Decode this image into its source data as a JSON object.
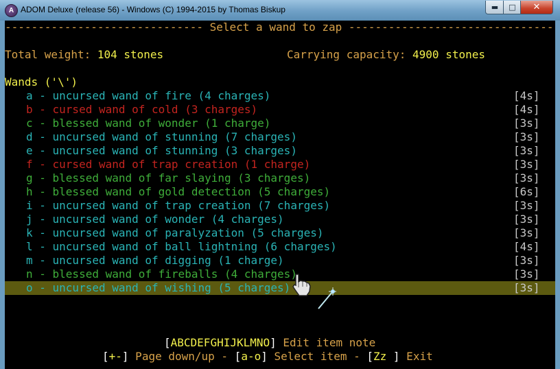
{
  "window": {
    "title": "ADOM Deluxe (release 56) - Windows (C) 1994-2015 by Thomas Biskup",
    "icon_label": "A",
    "buttons": {
      "minimize": "▬",
      "maximize": "□",
      "close": "✕"
    }
  },
  "header": {
    "rule_left": "------------------------------",
    "title": " Select a wand to zap ",
    "rule_right": "--------------------------------"
  },
  "stats": {
    "weight_label": "Total weight: ",
    "weight_value": "104 stones",
    "capacity_label": "Carrying capacity: ",
    "capacity_value": "4900 stones"
  },
  "category": "Wands ('\\')",
  "colors": {
    "uncursed": "#2ab4b6",
    "cursed": "#c3241f",
    "blessed": "#3fae3a",
    "selected_bg": "#5c5a10"
  },
  "items": [
    {
      "key": "a",
      "text": "a - uncursed wand of fire (4 charges)",
      "weight": "[4s]",
      "status": "uncursed"
    },
    {
      "key": "b",
      "text": "b - cursed wand of cold (3 charges)",
      "weight": "[4s]",
      "status": "cursed"
    },
    {
      "key": "c",
      "text": "c - blessed wand of wonder (1 charge)",
      "weight": "[3s]",
      "status": "blessed"
    },
    {
      "key": "d",
      "text": "d - uncursed wand of stunning (7 charges)",
      "weight": "[3s]",
      "status": "uncursed"
    },
    {
      "key": "e",
      "text": "e - uncursed wand of stunning (3 charges)",
      "weight": "[3s]",
      "status": "uncursed"
    },
    {
      "key": "f",
      "text": "f - cursed wand of trap creation (1 charge)",
      "weight": "[3s]",
      "status": "cursed"
    },
    {
      "key": "g",
      "text": "g - blessed wand of far slaying (3 charges)",
      "weight": "[3s]",
      "status": "blessed"
    },
    {
      "key": "h",
      "text": "h - blessed wand of gold detection (5 charges)",
      "weight": "[6s]",
      "status": "blessed"
    },
    {
      "key": "i",
      "text": "i - uncursed wand of trap creation (7 charges)",
      "weight": "[3s]",
      "status": "uncursed"
    },
    {
      "key": "j",
      "text": "j - uncursed wand of wonder (4 charges)",
      "weight": "[3s]",
      "status": "uncursed"
    },
    {
      "key": "k",
      "text": "k - uncursed wand of paralyzation (5 charges)",
      "weight": "[3s]",
      "status": "uncursed"
    },
    {
      "key": "l",
      "text": "l - uncursed wand of ball lightning (6 charges)",
      "weight": "[4s]",
      "status": "uncursed"
    },
    {
      "key": "m",
      "text": "m - uncursed wand of digging (1 charge)",
      "weight": "[3s]",
      "status": "uncursed"
    },
    {
      "key": "n",
      "text": "n - blessed wand of fireballs (4 charges)",
      "weight": "[3s]",
      "status": "blessed"
    },
    {
      "key": "o",
      "text": "o - uncursed wand of wishing (5 charges)",
      "weight": "[3s]",
      "status": "uncursed",
      "selected": true
    }
  ],
  "footer": {
    "note_keys": "ABCDEFGHIJKLMNO",
    "note_label": " Edit item note",
    "page_keys": "+-",
    "page_label": " Page down/up - ",
    "select_keys": "a-o",
    "select_label": " Select item - ",
    "exit_keys": "Zz ",
    "exit_label": " Exit"
  },
  "icons": {
    "cursor": "hand-pointer-icon",
    "magic_cursor": "magic-wand-icon"
  }
}
